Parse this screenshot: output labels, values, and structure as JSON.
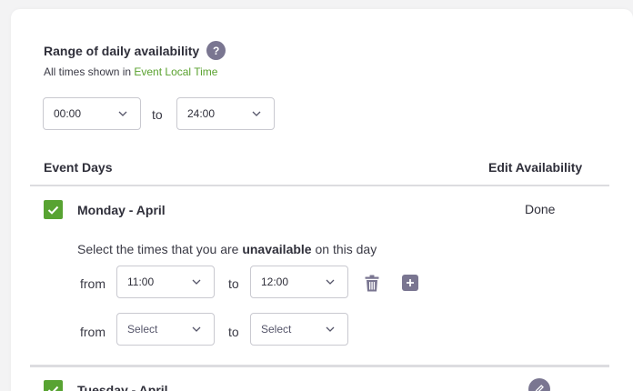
{
  "range": {
    "title": "Range of daily availability",
    "help_icon_text": "?",
    "subtitle_prefix": "All times shown in ",
    "subtitle_link": "Event Local Time",
    "start_value": "00:00",
    "to_label": "to",
    "end_value": "24:00"
  },
  "table": {
    "col_days": "Event Days",
    "col_edit": "Edit Availability"
  },
  "days": [
    {
      "label": "Monday - April",
      "action": "Done",
      "instruction_prefix": "Select the times that you are ",
      "instruction_bold": "unavailable",
      "instruction_suffix": " on this day",
      "rows": [
        {
          "from_label": "from",
          "from_value": "11:00",
          "to_label": "to",
          "to_value": "12:00"
        },
        {
          "from_label": "from",
          "from_value": "Select",
          "to_label": "to",
          "to_value": "Select"
        }
      ]
    },
    {
      "label": "Tuesday - April"
    }
  ],
  "colors": {
    "accent_green": "#58a332",
    "link_green": "#5aa22f",
    "icon_purple": "#7a7691"
  }
}
